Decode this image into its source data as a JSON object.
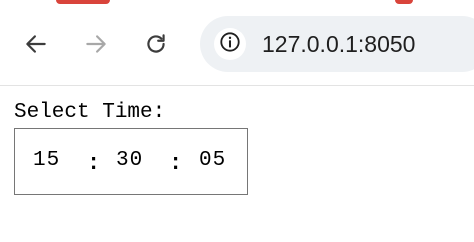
{
  "browser": {
    "url": "127.0.0.1:8050",
    "icons": {
      "back": "arrow-left-icon",
      "forward": "arrow-right-icon",
      "reload": "reload-icon",
      "site_info": "info-icon"
    },
    "accent_color": "#d9443b"
  },
  "page": {
    "label": "Select Time:",
    "time": {
      "hours": "15",
      "minutes": "30",
      "seconds": "05",
      "separator": ":"
    }
  }
}
